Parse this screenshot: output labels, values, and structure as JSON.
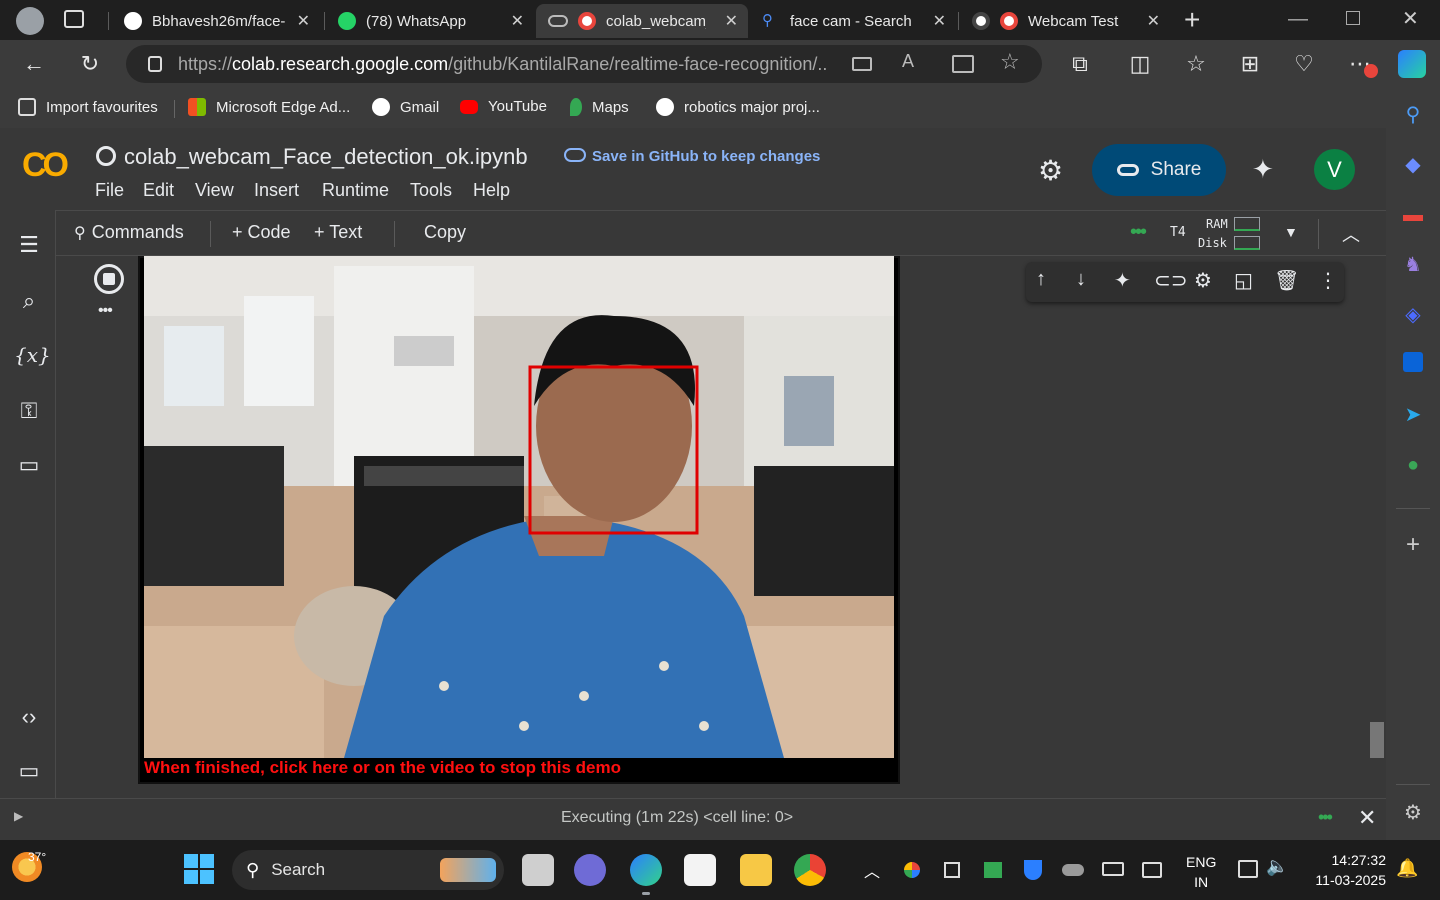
{
  "tabs": [
    {
      "title": "Bbhavesh26m/face-",
      "icon": "github-icon"
    },
    {
      "title": "(78) WhatsApp",
      "icon": "whatsapp-icon",
      "badge": "78"
    },
    {
      "title": "colab_webcam_",
      "icon": "colab-icon",
      "recording": true
    },
    {
      "title": "face cam - Search",
      "icon": "search-icon"
    },
    {
      "title": "Webcam Test",
      "icon": "webcam-icon",
      "recording": true
    }
  ],
  "address": {
    "prefix": "https://",
    "domain": "colab.research.google.com",
    "path": "/github/KantilalRane/realtime-face-recognition/..."
  },
  "bookmarks": [
    "Import favourites",
    "Microsoft Edge Ad...",
    "Gmail",
    "YouTube",
    "Maps",
    "robotics major proj..."
  ],
  "colab": {
    "logo": "CO",
    "notebook_title": "colab_webcam_Face_detection_ok.ipynb",
    "save_hint": "Save in GitHub to keep changes",
    "share_label": "Share",
    "avatar_letter": "V",
    "menu": [
      "File",
      "Edit",
      "View",
      "Insert",
      "Runtime",
      "Tools",
      "Help"
    ],
    "toolbar": {
      "commands": "Commands",
      "code": "+ Code",
      "text": "+ Text",
      "copy": "Copy",
      "runtime": "T4",
      "ram": "RAM",
      "disk": "Disk"
    },
    "output": {
      "stop_message": "When finished, click here or on the video to stop this demo"
    },
    "status": "Executing (1m 22s) <cell line: 0>"
  },
  "colors": {
    "accent": "#f9ab00",
    "share_bg": "#004a77",
    "avatar_bg": "#0b8043",
    "link_blue": "#8ab4f8",
    "face_box": "#e00000"
  },
  "taskbar": {
    "weather": "37°",
    "search_placeholder": "Search",
    "lang_top": "ENG",
    "lang_bottom": "IN",
    "time": "14:27:32",
    "date": "11-03-2025"
  }
}
